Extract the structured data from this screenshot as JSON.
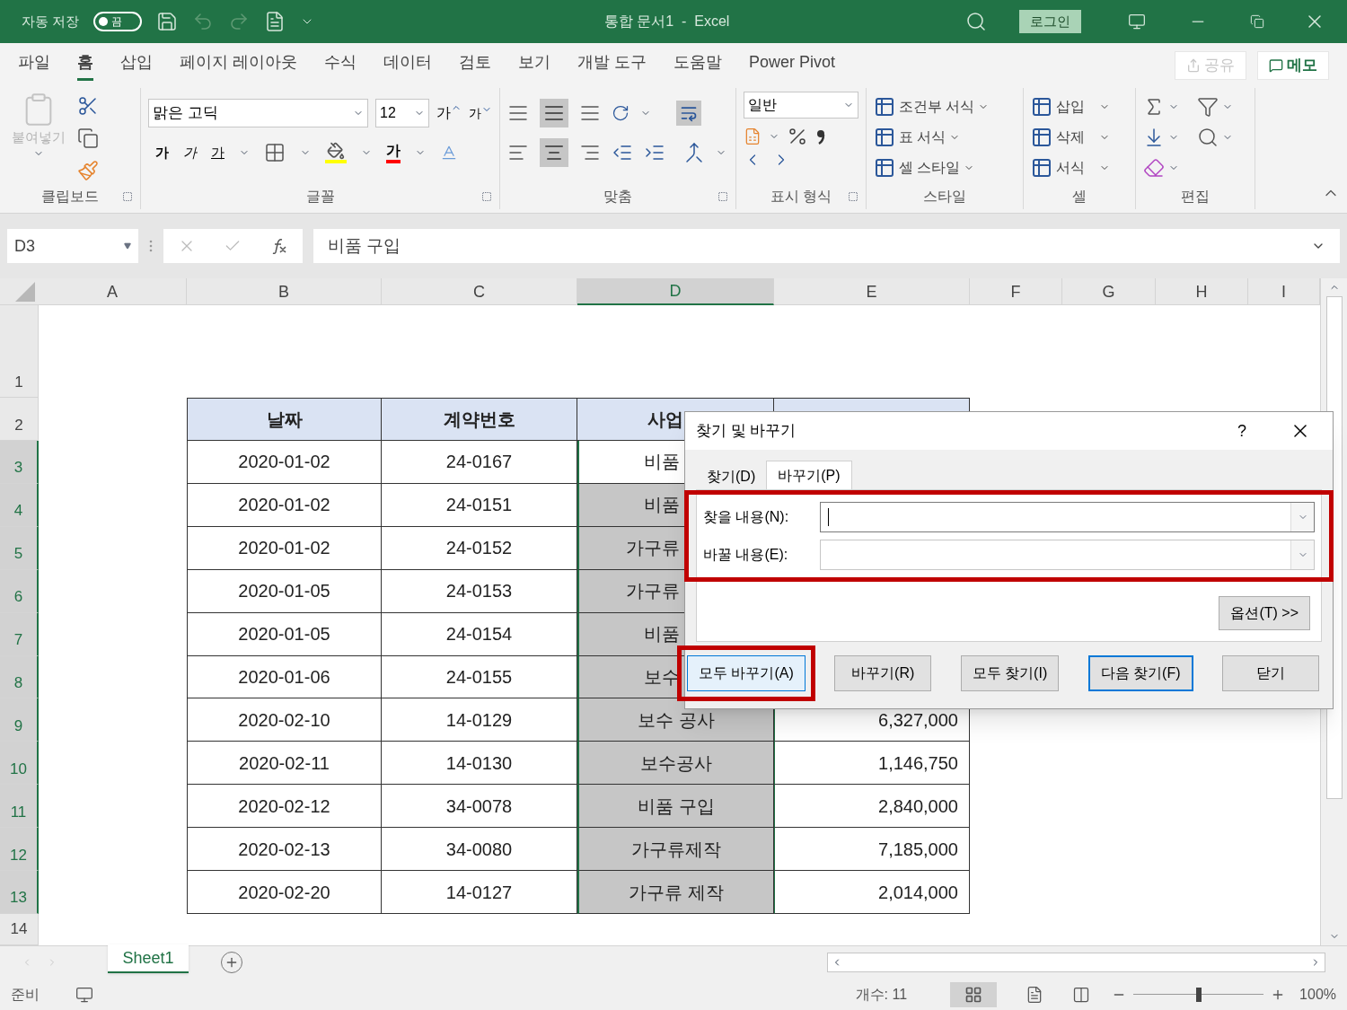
{
  "title_bar": {
    "autosave_label": "자동 저장",
    "autosave": {
      "label": "끔",
      "on": false
    },
    "document_title": "통합 문서1  -  Excel",
    "login": "로그인"
  },
  "menu_tabs": [
    {
      "label": "파일",
      "selected": false
    },
    {
      "label": "홈",
      "selected": true
    },
    {
      "label": "삽입",
      "selected": false
    },
    {
      "label": "페이지 레이아웃",
      "selected": false
    },
    {
      "label": "수식",
      "selected": false
    },
    {
      "label": "데이터",
      "selected": false
    },
    {
      "label": "검토",
      "selected": false
    },
    {
      "label": "보기",
      "selected": false
    },
    {
      "label": "개발 도구",
      "selected": false
    },
    {
      "label": "도움말",
      "selected": false
    },
    {
      "label": "Power Pivot",
      "selected": false
    }
  ],
  "share": {
    "label": "공유",
    "disabled": true
  },
  "memo": "메모",
  "ribbon": {
    "clipboard": {
      "label": "클립보드",
      "paste": "붙여넣기"
    },
    "font": {
      "label": "글꼴",
      "font_name": "맑은 고딕",
      "font_size": "12",
      "grow": "가",
      "shrink": "가",
      "bold": "가",
      "italic": "가",
      "underline": "가",
      "font_color": "가"
    },
    "alignment": {
      "label": "맞춤"
    },
    "number": {
      "label": "표시 형식",
      "format": "일반"
    },
    "styles": {
      "label": "스타일",
      "items": [
        "조건부 서식",
        "표 서식",
        "셀 스타일"
      ]
    },
    "cells": {
      "label": "셀",
      "items": [
        "삽입",
        "삭제",
        "서식"
      ]
    },
    "editing": {
      "label": "편집"
    }
  },
  "formula_bar": {
    "name_box": "D3",
    "formula": "비품 구입"
  },
  "columns": [
    {
      "label": "A",
      "selected": false
    },
    {
      "label": "B",
      "selected": false
    },
    {
      "label": "C",
      "selected": false
    },
    {
      "label": "D",
      "selected": true
    },
    {
      "label": "E",
      "selected": false
    },
    {
      "label": "F",
      "selected": false
    },
    {
      "label": "G",
      "selected": false
    },
    {
      "label": "H",
      "selected": false
    },
    {
      "label": "I",
      "selected": false
    }
  ],
  "table_header": {
    "row": "2",
    "cells": [
      "날짜",
      "계약번호",
      "사업"
    ]
  },
  "rows": [
    {
      "row": "3",
      "selected": true,
      "active": true,
      "date": "2020-01-02",
      "contract": "24-0167",
      "business": "비품"
    },
    {
      "row": "4",
      "selected": true,
      "active": false,
      "date": "2020-01-02",
      "contract": "24-0151",
      "business": "비품"
    },
    {
      "row": "5",
      "selected": true,
      "active": false,
      "date": "2020-01-02",
      "contract": "24-0152",
      "business": "가구류"
    },
    {
      "row": "6",
      "selected": true,
      "active": false,
      "date": "2020-01-05",
      "contract": "24-0153",
      "business": "가구류"
    },
    {
      "row": "7",
      "selected": true,
      "active": false,
      "date": "2020-01-05",
      "contract": "24-0154",
      "business": "비품"
    },
    {
      "row": "8",
      "selected": true,
      "active": false,
      "date": "2020-01-06",
      "contract": "24-0155",
      "business": "보수"
    },
    {
      "row": "9",
      "selected": true,
      "active": false,
      "date": "2020-02-10",
      "contract": "14-0129",
      "business": "보수 공사",
      "amount": "6,327,000"
    },
    {
      "row": "10",
      "selected": true,
      "active": false,
      "date": "2020-02-11",
      "contract": "14-0130",
      "business": "보수공사",
      "amount": "1,146,750"
    },
    {
      "row": "11",
      "selected": true,
      "active": false,
      "date": "2020-02-12",
      "contract": "34-0078",
      "business": "비품 구입",
      "amount": "2,840,000"
    },
    {
      "row": "12",
      "selected": true,
      "active": false,
      "date": "2020-02-13",
      "contract": "34-0080",
      "business": "가구류제작",
      "amount": "7,185,000"
    },
    {
      "row": "13",
      "selected": true,
      "active": false,
      "date": "2020-02-20",
      "contract": "14-0127",
      "business": "가구류 제작",
      "amount": "2,014,000"
    }
  ],
  "row_labels": {
    "first": "1",
    "last": "14"
  },
  "sheet_tabs": [
    {
      "label": "Sheet1",
      "selected": true
    }
  ],
  "status_bar": {
    "ready": "준비",
    "count": "개수: 11",
    "zoom": {
      "label": "100%",
      "level": 0.5
    }
  },
  "dialog": {
    "title": "찾기 및 바꾸기",
    "help": "?",
    "tabs": [
      {
        "label": "찾기(D)",
        "selected": false
      },
      {
        "label": "바꾸기(P)",
        "selected": true
      }
    ],
    "fields": [
      {
        "label": "찾을 내용(N):",
        "focused": true
      },
      {
        "label": "바꿀 내용(E):",
        "focused": false
      }
    ],
    "fields_highlighted": true,
    "options": "옵션(T) >>",
    "buttons": [
      {
        "label": "모두 바꾸기(A)",
        "highlighted": true,
        "default": false,
        "focused": true
      },
      {
        "label": "바꾸기(R)",
        "highlighted": false,
        "default": false,
        "focused": false
      },
      {
        "label": "모두 찾기(I)",
        "highlighted": false,
        "default": false,
        "focused": false
      },
      {
        "label": "다음 찾기(F)",
        "highlighted": false,
        "default": true,
        "focused": false
      },
      {
        "label": "닫기",
        "highlighted": false,
        "default": false,
        "focused": false
      }
    ]
  }
}
